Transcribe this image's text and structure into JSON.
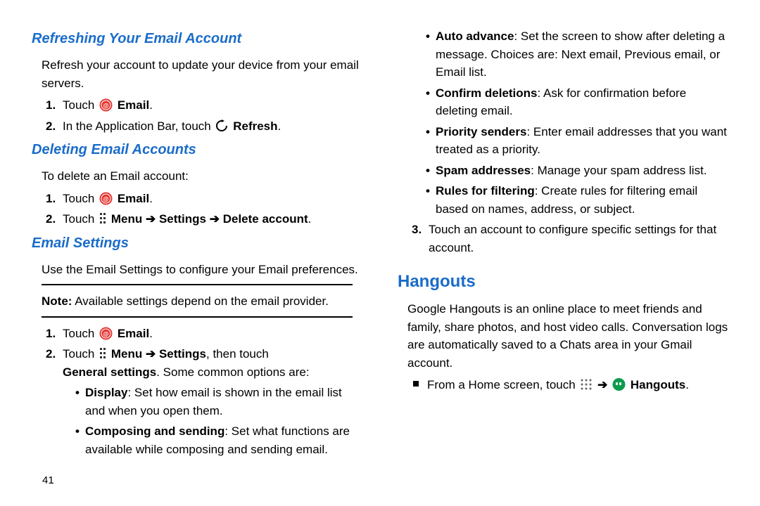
{
  "page_number": "41",
  "left": {
    "refresh": {
      "title": "Refreshing Your Email Account",
      "intro": "Refresh your account to update your device from your email servers.",
      "step1_a": "Touch ",
      "step1_b": "Email",
      "step2_a": "In the Application Bar, touch ",
      "step2_b": "Refresh"
    },
    "delete": {
      "title": "Deleting Email Accounts",
      "intro": "To delete an Email account:",
      "step1_a": "Touch ",
      "step1_b": "Email",
      "step2_a": "Touch ",
      "step2_b": "Menu",
      "step2_c": "Settings",
      "step2_d": "Delete account"
    },
    "settings": {
      "title": "Email Settings",
      "intro": "Use the Email Settings to configure your Email preferences.",
      "note_prefix": "Note:",
      "note_text": " Available settings depend on the email provider.",
      "step1_a": "Touch ",
      "step1_b": "Email",
      "step2_a": "Touch ",
      "step2_b": "Menu",
      "step2_c": "Settings",
      "step2_d": ", then touch",
      "step2_e": "General settings",
      "step2_f": ". Some common options are:",
      "opt_display_b": "Display",
      "opt_display_t": ": Set how email is shown in the email list and when you open them.",
      "opt_compose_b": "Composing and sending",
      "opt_compose_t": ": Set what functions are available while composing and sending email."
    }
  },
  "right": {
    "auto_advance_b": "Auto advance",
    "auto_advance_t": ": Set the screen to show after deleting a message. Choices are: Next email, Previous email, or Email list.",
    "confirm_b": "Confirm deletions",
    "confirm_t": ": Ask for confirmation before deleting email.",
    "priority_b": "Priority senders",
    "priority_t": ": Enter email addresses that you want treated as a priority.",
    "spam_b": "Spam addresses",
    "spam_t": ": Manage your spam address list.",
    "rules_b": "Rules for filtering",
    "rules_t": ": Create rules for filtering email based on names, address, or subject.",
    "step3": "Touch an account to configure specific settings for that account.",
    "hangouts": {
      "title": "Hangouts",
      "intro": "Google Hangouts is an online place to meet friends and family, share photos, and host video calls. Conversation logs are automatically saved to a Chats area in your Gmail account.",
      "line_a": "From a Home screen, touch ",
      "label": "Hangouts"
    }
  },
  "arrow": "➔"
}
